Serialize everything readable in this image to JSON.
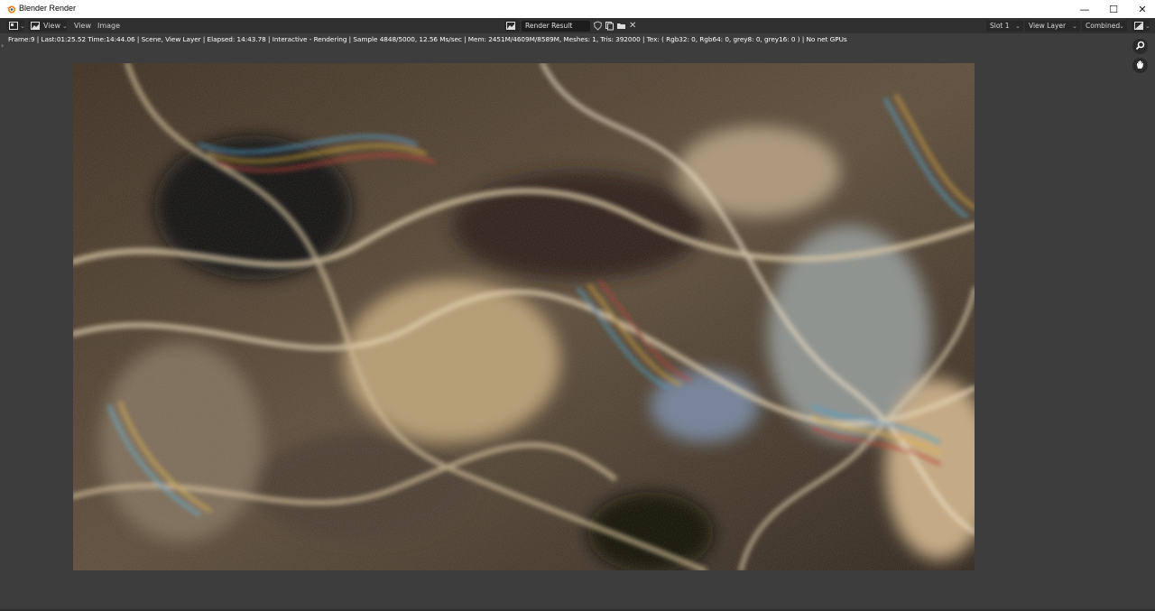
{
  "window": {
    "title": "Blender Render",
    "minimize": "—",
    "maximize": "☐",
    "close": "✕"
  },
  "header": {
    "view_dropdown": "View",
    "menus": [
      "View",
      "Image"
    ],
    "image_name": "Render Result",
    "slot": "Slot 1",
    "view_layer": "View Layer",
    "pass": "Combined"
  },
  "status": {
    "text": "Frame:9 | Last:01:25.52 Time:14:44.06 | Scene, View Layer | Elapsed: 14:43.78 | Interactive - Rendering | Sample 4848/5000, 12.56 Ms/sec | Mem: 2451M/4609M/8589M, Meshes: 1, Tris: 392000 | Tex: ( Rgb32: 0, Rgb64: 0, grey8: 0, grey16: 0 ) | No net GPUs"
  },
  "render": {
    "description_icon": "render-result-image"
  },
  "colors": {
    "background": "#3d3d3d",
    "header": "#303030",
    "field": "#1d1d1d"
  }
}
